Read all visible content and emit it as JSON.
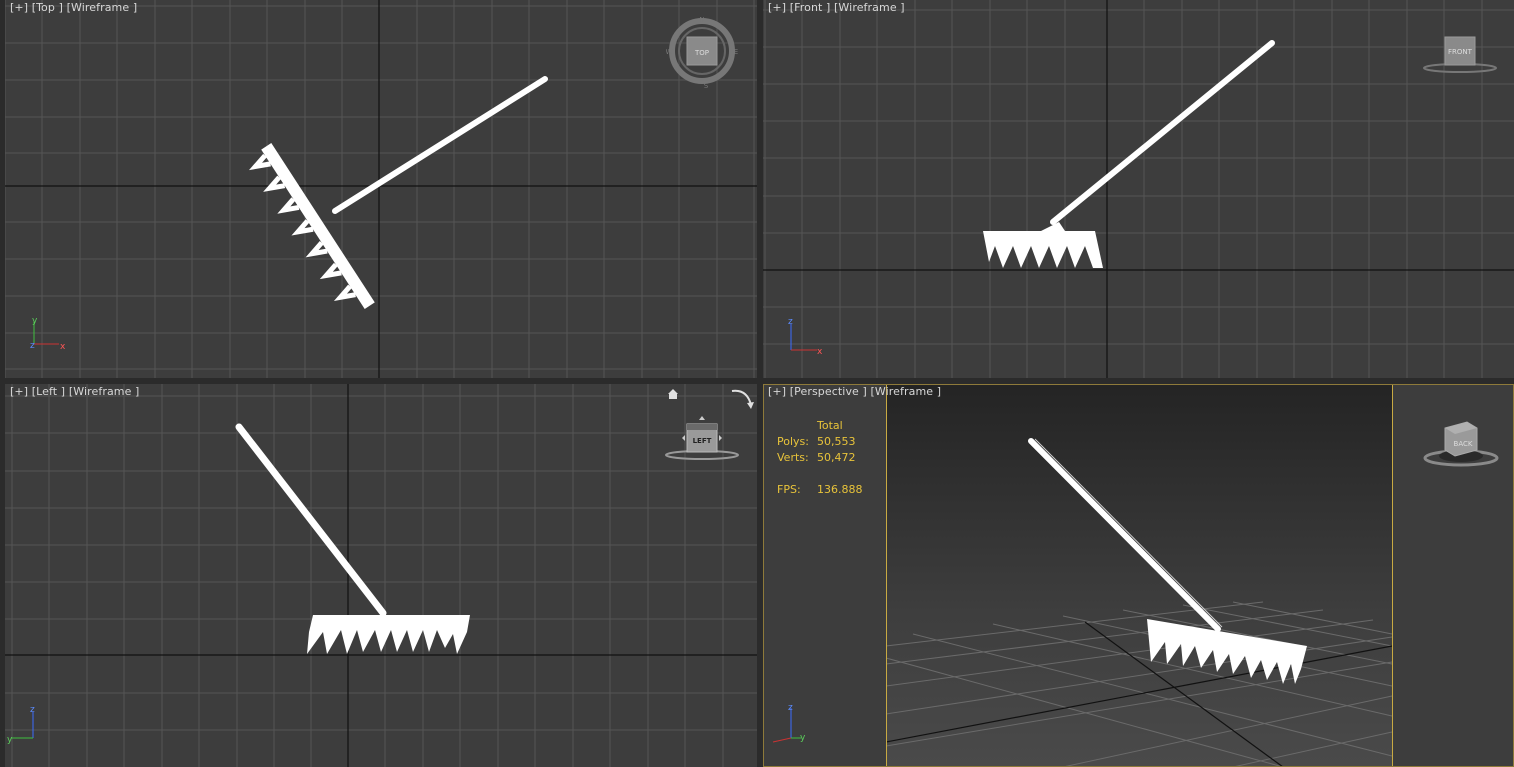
{
  "viewports": {
    "top": {
      "plus": "[+]",
      "view": "[Top ]",
      "mode": "[Wireframe ]",
      "cube_label": "TOP",
      "compass": [
        "N",
        "W",
        "E",
        "S"
      ],
      "axis": [
        "y",
        "z",
        "x"
      ]
    },
    "front": {
      "plus": "[+]",
      "view": "[Front ]",
      "mode": "[Wireframe ]",
      "cube_label": "FRONT",
      "axis": [
        "z",
        "x"
      ]
    },
    "left": {
      "plus": "[+]",
      "view": "[Left ]",
      "mode": "[Wireframe ]",
      "cube_label": "LEFT",
      "axis": [
        "z",
        "y"
      ]
    },
    "perspective": {
      "plus": "[+]",
      "view": "[Perspective ]",
      "mode": "[Wireframe ]",
      "cube_label": "BACK",
      "axis": [
        "z",
        "y"
      ]
    }
  },
  "stats": {
    "header": "Total",
    "polys_label": "Polys:",
    "polys_value": "50,553",
    "verts_label": "Verts:",
    "verts_value": "50,472",
    "fps_label": "FPS:",
    "fps_value": "136.888"
  },
  "colors": {
    "viewport_bg": "#3d3d3d",
    "grid_line": "#555555",
    "axis_line": "#111111",
    "label_text": "#d8d8d8",
    "stats_text": "#e8c33a",
    "active_border": "#c8aa43",
    "model": "#ffffff"
  },
  "icons": {
    "viewcube": "viewcube-icon",
    "compass": "compass-ring-icon",
    "home": "home-icon",
    "orbit": "orbit-arrows-icon",
    "axis_tripod": "axis-tripod-icon"
  }
}
